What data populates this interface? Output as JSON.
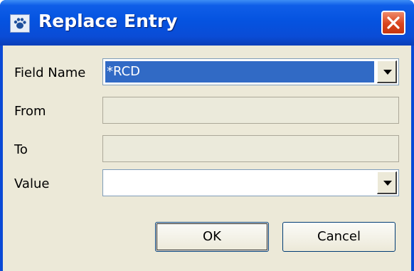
{
  "window": {
    "title": "Replace Entry",
    "app_icon": "dialog-app-icon",
    "close_icon": "close-icon"
  },
  "form": {
    "field_name": {
      "label": "Field Name",
      "value": "*RCD"
    },
    "from": {
      "label": "From",
      "value": ""
    },
    "to": {
      "label": "To",
      "value": ""
    },
    "value": {
      "label": "Value",
      "value": ""
    }
  },
  "buttons": {
    "ok": "OK",
    "cancel": "Cancel"
  },
  "colors": {
    "titlebar": "#0553e0",
    "face": "#ece9d8",
    "selection": "#316ac5",
    "close": "#d9441e"
  }
}
